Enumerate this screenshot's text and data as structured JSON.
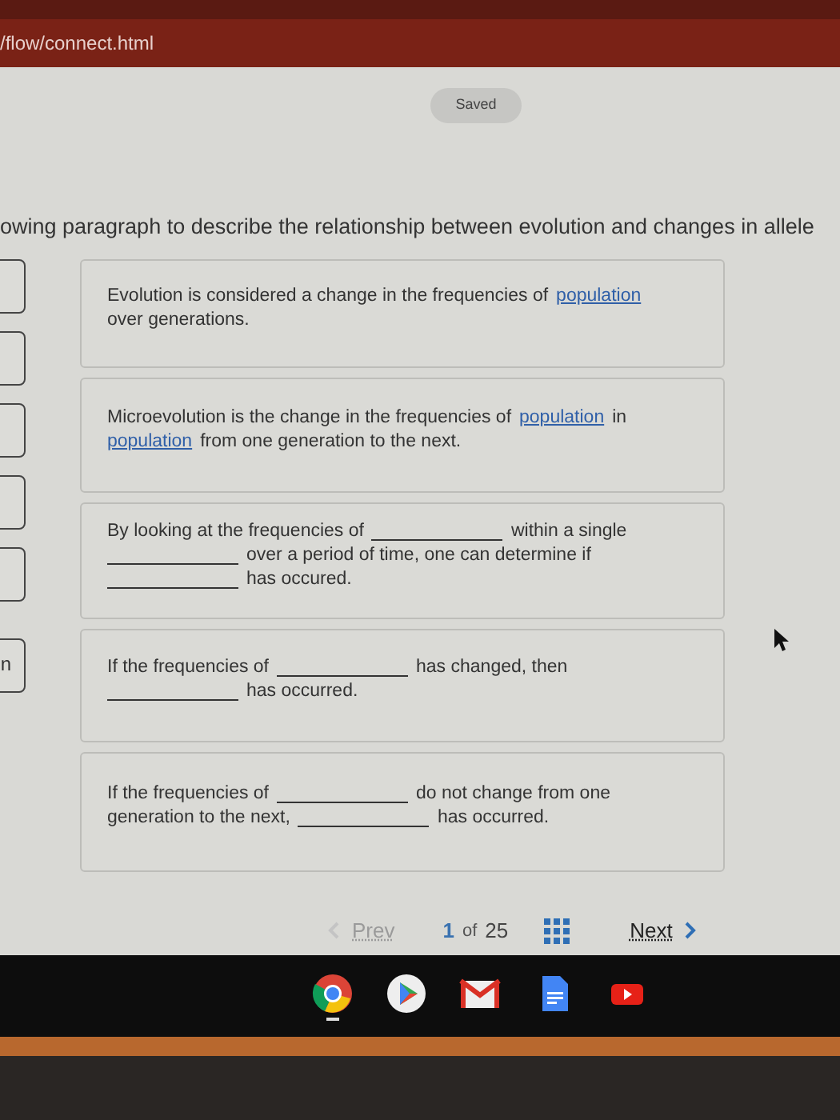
{
  "browser": {
    "url": "/flow/connect.html"
  },
  "saved_badge": "Saved",
  "instruction": "owing paragraph to describe the relationship between evolution and changes in allele",
  "answer_tiles": [
    {
      "kind": "empty"
    },
    {
      "kind": "empty"
    },
    {
      "kind": "empty"
    },
    {
      "kind": "empty"
    },
    {
      "kind": "empty"
    },
    {
      "kind": "label",
      "label": "n"
    }
  ],
  "cards": [
    {
      "lines": [
        [
          {
            "kind": "text",
            "text": "Evolution is considered a change in the frequencies of"
          },
          {
            "kind": "filled",
            "text": "population"
          }
        ],
        [
          {
            "kind": "text",
            "text": "over generations."
          }
        ]
      ]
    },
    {
      "lines": [
        [
          {
            "kind": "text",
            "text": "Microevolution is the change in the frequencies of"
          },
          {
            "kind": "filled",
            "text": "population"
          },
          {
            "kind": "text",
            "text": "in"
          }
        ],
        [
          {
            "kind": "filled",
            "text": "population"
          },
          {
            "kind": "text",
            "text": "from one generation to the next."
          }
        ]
      ]
    },
    {
      "lines": [
        [
          {
            "kind": "text",
            "text": "By looking at the frequencies of"
          },
          {
            "kind": "blank"
          },
          {
            "kind": "text",
            "text": "within a single"
          }
        ],
        [
          {
            "kind": "blank"
          },
          {
            "kind": "text",
            "text": "over a period of time, one can determine if"
          }
        ],
        [
          {
            "kind": "blank"
          },
          {
            "kind": "text",
            "text": "has occured."
          }
        ]
      ]
    },
    {
      "lines": [
        [
          {
            "kind": "text",
            "text": "If the frequencies of"
          },
          {
            "kind": "blank"
          },
          {
            "kind": "text",
            "text": "has changed, then"
          }
        ],
        [
          {
            "kind": "blank"
          },
          {
            "kind": "text",
            "text": "has occurred."
          }
        ]
      ]
    },
    {
      "lines": [
        [
          {
            "kind": "text",
            "text": "If the frequencies of"
          },
          {
            "kind": "blank"
          },
          {
            "kind": "text",
            "text": "do not change from one"
          }
        ],
        [
          {
            "kind": "text",
            "text": "generation to the next,"
          },
          {
            "kind": "blank"
          },
          {
            "kind": "text",
            "text": "has occurred."
          }
        ]
      ]
    }
  ],
  "pagination": {
    "prev": {
      "label": "Prev",
      "disabled": true
    },
    "current": "1",
    "of": "of",
    "total": "25",
    "next": {
      "label": "Next",
      "disabled": false
    }
  },
  "taskbar": [
    {
      "kind": "browser",
      "running": true
    },
    {
      "kind": "play",
      "running": false
    },
    {
      "kind": "mail",
      "running": false
    },
    {
      "kind": "doc",
      "running": false
    },
    {
      "kind": "video",
      "running": false
    }
  ]
}
